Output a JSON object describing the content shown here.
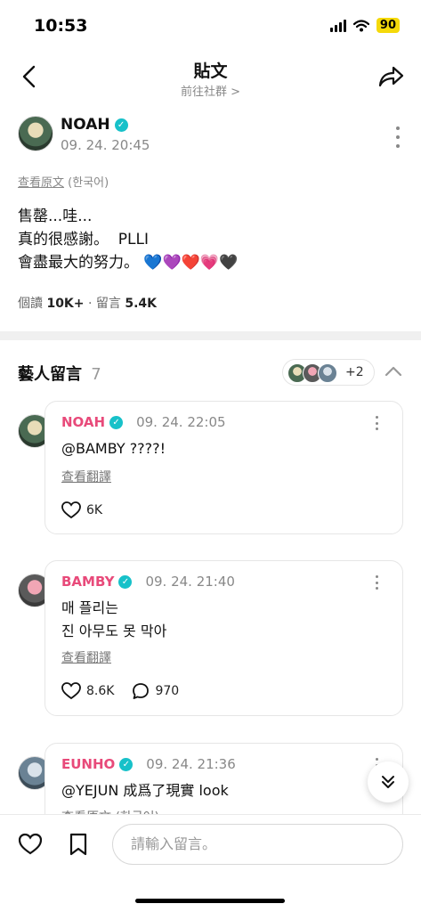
{
  "status": {
    "time": "10:53",
    "battery": "90"
  },
  "header": {
    "title": "貼文",
    "subtitle": "前往社群 >"
  },
  "post": {
    "author": "NOAH",
    "time": "09. 24. 20:45",
    "view_original": "查看原文",
    "original_lang": "(한국어)",
    "lines": [
      "售罄...哇...",
      "真的很感謝。  PLLI",
      "會盡最大的努力。 💙💜❤️💗🖤"
    ],
    "views_label": "個讀",
    "views_value": "10K+",
    "comments_label": "留言",
    "comments_value": "5.4K"
  },
  "artist_comments": {
    "title": "藝人留言",
    "count": "7",
    "more_count": "+2"
  },
  "comments": [
    {
      "author": "NOAH",
      "time": "09. 24. 22:05",
      "lines": [
        "@BAMBY ????!"
      ],
      "translate": "查看翻譯",
      "likes": "6K"
    },
    {
      "author": "BAMBY",
      "time": "09. 24. 21:40",
      "lines": [
        "매 플리는",
        "진 아무도 못 막아"
      ],
      "translate": "查看翻譯",
      "likes": "8.6K",
      "replies": "970"
    },
    {
      "author": "EUNHO",
      "time": "09. 24. 21:36",
      "lines": [
        "@YEJUN 成爲了現實 look"
      ],
      "translate": "查看原文 (한국어)"
    }
  ],
  "input": {
    "placeholder": "請輸入留言。"
  },
  "colors": {
    "accent": "#17c1c9",
    "artist_name": "#e84a7a"
  }
}
